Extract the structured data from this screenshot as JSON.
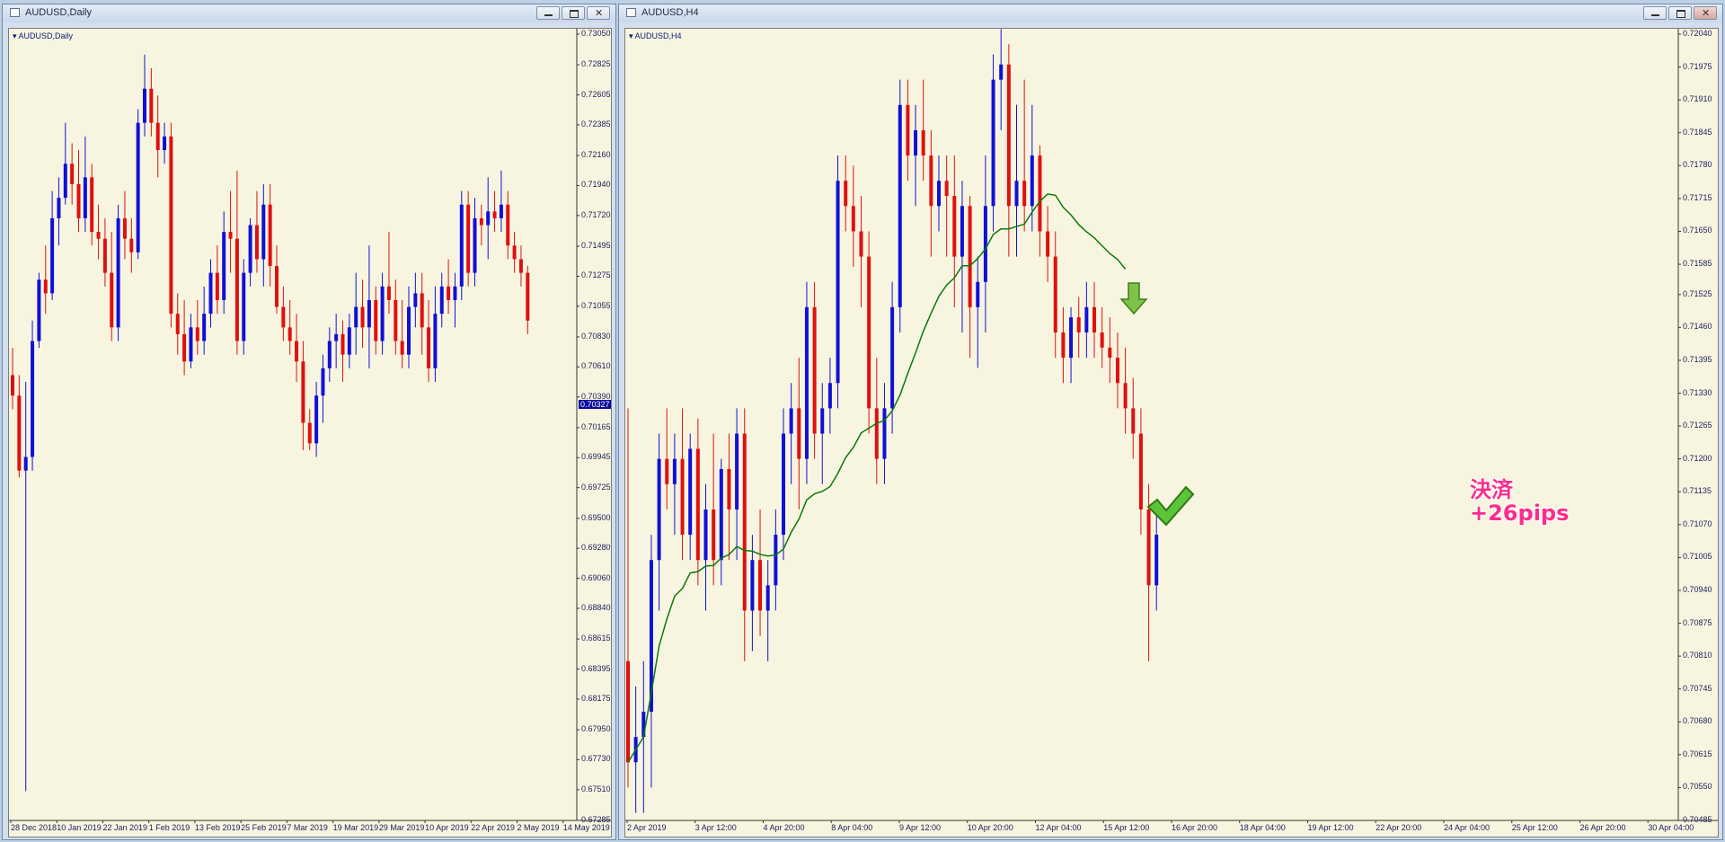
{
  "windows": [
    {
      "title": "AUDUSD,Daily",
      "symbol_label": "AUDUSD,Daily",
      "price_tag": "0.70327",
      "y_labels": [
        "0.73050",
        "0.72825",
        "0.72605",
        "0.72385",
        "0.72160",
        "0.71940",
        "0.71720",
        "0.71495",
        "0.71275",
        "0.71055",
        "0.70830",
        "0.70610",
        "0.70390",
        "0.70165",
        "0.69945",
        "0.69725",
        "0.69500",
        "0.69280",
        "0.69060",
        "0.68840",
        "0.68615",
        "0.68395",
        "0.68175",
        "0.67950",
        "0.67730",
        "0.67510",
        "0.67285"
      ],
      "x_labels": [
        "28 Dec 2018",
        "10 Jan 2019",
        "22 Jan 2019",
        "1 Feb 2019",
        "13 Feb 2019",
        "25 Feb 2019",
        "7 Mar 2019",
        "19 Mar 2019",
        "29 Mar 2019",
        "10 Apr 2019",
        "22 Apr 2019",
        "2 May 2019",
        "14 May 2019"
      ]
    },
    {
      "title": "AUDUSD,H4",
      "symbol_label": "AUDUSD,H4",
      "y_labels": [
        "0.72040",
        "0.71975",
        "0.71910",
        "0.71845",
        "0.71780",
        "0.71715",
        "0.71650",
        "0.71585",
        "0.71525",
        "0.71460",
        "0.71395",
        "0.71330",
        "0.71265",
        "0.71200",
        "0.71135",
        "0.71070",
        "0.71005",
        "0.70940",
        "0.70875",
        "0.70810",
        "0.70745",
        "0.70680",
        "0.70615",
        "0.70550",
        "0.70485"
      ],
      "x_labels": [
        "2 Apr 2019",
        "3 Apr 12:00",
        "4 Apr 20:00",
        "8 Apr 04:00",
        "9 Apr 12:00",
        "10 Apr 20:00",
        "12 Apr 04:00",
        "15 Apr 12:00",
        "16 Apr 20:00",
        "18 Apr 04:00",
        "19 Apr 12:00",
        "22 Apr 20:00",
        "24 Apr 04:00",
        "25 Apr 12:00",
        "26 Apr 20:00",
        "30 Apr 04:00"
      ],
      "annotation_line1": "決済",
      "annotation_line2": "+26pips"
    }
  ],
  "colors": {
    "bull": "#1010d8",
    "bear": "#e01010",
    "ma": "#0a7a0a",
    "bg": "#f7f5df",
    "annotation": "#ff2b8c"
  },
  "chart_data": [
    {
      "type": "candlestick",
      "title": "AUDUSD,Daily",
      "ylim": [
        0.67285,
        0.7305
      ],
      "series": [
        {
          "o": 0.7055,
          "h": 0.7075,
          "l": 0.703,
          "c": 0.704
        },
        {
          "o": 0.704,
          "h": 0.7055,
          "l": 0.698,
          "c": 0.6985
        },
        {
          "o": 0.6985,
          "h": 0.705,
          "l": 0.675,
          "c": 0.6995
        },
        {
          "o": 0.6995,
          "h": 0.7095,
          "l": 0.6985,
          "c": 0.708
        },
        {
          "o": 0.708,
          "h": 0.713,
          "l": 0.7075,
          "c": 0.7125
        },
        {
          "o": 0.7125,
          "h": 0.715,
          "l": 0.71,
          "c": 0.7115
        },
        {
          "o": 0.7115,
          "h": 0.719,
          "l": 0.711,
          "c": 0.717
        },
        {
          "o": 0.717,
          "h": 0.72,
          "l": 0.715,
          "c": 0.7185
        },
        {
          "o": 0.7185,
          "h": 0.724,
          "l": 0.718,
          "c": 0.721
        },
        {
          "o": 0.721,
          "h": 0.7225,
          "l": 0.718,
          "c": 0.7195
        },
        {
          "o": 0.7195,
          "h": 0.722,
          "l": 0.716,
          "c": 0.717
        },
        {
          "o": 0.717,
          "h": 0.723,
          "l": 0.716,
          "c": 0.72
        },
        {
          "o": 0.72,
          "h": 0.721,
          "l": 0.715,
          "c": 0.716
        },
        {
          "o": 0.716,
          "h": 0.718,
          "l": 0.714,
          "c": 0.7155
        },
        {
          "o": 0.7155,
          "h": 0.717,
          "l": 0.712,
          "c": 0.713
        },
        {
          "o": 0.713,
          "h": 0.716,
          "l": 0.708,
          "c": 0.709
        },
        {
          "o": 0.709,
          "h": 0.718,
          "l": 0.708,
          "c": 0.717
        },
        {
          "o": 0.717,
          "h": 0.719,
          "l": 0.714,
          "c": 0.7155
        },
        {
          "o": 0.7155,
          "h": 0.717,
          "l": 0.713,
          "c": 0.7145
        },
        {
          "o": 0.7145,
          "h": 0.725,
          "l": 0.714,
          "c": 0.724
        },
        {
          "o": 0.724,
          "h": 0.729,
          "l": 0.723,
          "c": 0.7265
        },
        {
          "o": 0.7265,
          "h": 0.728,
          "l": 0.723,
          "c": 0.724
        },
        {
          "o": 0.724,
          "h": 0.726,
          "l": 0.72,
          "c": 0.722
        },
        {
          "o": 0.722,
          "h": 0.724,
          "l": 0.721,
          "c": 0.723
        },
        {
          "o": 0.723,
          "h": 0.724,
          "l": 0.709,
          "c": 0.71
        },
        {
          "o": 0.71,
          "h": 0.7115,
          "l": 0.707,
          "c": 0.7085
        },
        {
          "o": 0.7085,
          "h": 0.711,
          "l": 0.7055,
          "c": 0.7065
        },
        {
          "o": 0.7065,
          "h": 0.71,
          "l": 0.706,
          "c": 0.709
        },
        {
          "o": 0.709,
          "h": 0.711,
          "l": 0.707,
          "c": 0.708
        },
        {
          "o": 0.708,
          "h": 0.712,
          "l": 0.707,
          "c": 0.71
        },
        {
          "o": 0.71,
          "h": 0.714,
          "l": 0.709,
          "c": 0.713
        },
        {
          "o": 0.713,
          "h": 0.715,
          "l": 0.71,
          "c": 0.711
        },
        {
          "o": 0.711,
          "h": 0.7175,
          "l": 0.71,
          "c": 0.716
        },
        {
          "o": 0.716,
          "h": 0.719,
          "l": 0.713,
          "c": 0.7155
        },
        {
          "o": 0.7155,
          "h": 0.7205,
          "l": 0.707,
          "c": 0.708
        },
        {
          "o": 0.708,
          "h": 0.714,
          "l": 0.707,
          "c": 0.713
        },
        {
          "o": 0.713,
          "h": 0.717,
          "l": 0.712,
          "c": 0.7165
        },
        {
          "o": 0.7165,
          "h": 0.719,
          "l": 0.713,
          "c": 0.714
        },
        {
          "o": 0.714,
          "h": 0.7195,
          "l": 0.712,
          "c": 0.718
        },
        {
          "o": 0.718,
          "h": 0.7195,
          "l": 0.712,
          "c": 0.7135
        },
        {
          "o": 0.7135,
          "h": 0.715,
          "l": 0.71,
          "c": 0.7105
        },
        {
          "o": 0.7105,
          "h": 0.712,
          "l": 0.708,
          "c": 0.709
        },
        {
          "o": 0.709,
          "h": 0.711,
          "l": 0.707,
          "c": 0.708
        },
        {
          "o": 0.708,
          "h": 0.71,
          "l": 0.705,
          "c": 0.7065
        },
        {
          "o": 0.7065,
          "h": 0.708,
          "l": 0.7,
          "c": 0.702
        },
        {
          "o": 0.702,
          "h": 0.703,
          "l": 0.7,
          "c": 0.7005
        },
        {
          "o": 0.7005,
          "h": 0.705,
          "l": 0.6995,
          "c": 0.704
        },
        {
          "o": 0.704,
          "h": 0.707,
          "l": 0.702,
          "c": 0.706
        },
        {
          "o": 0.706,
          "h": 0.709,
          "l": 0.705,
          "c": 0.708
        },
        {
          "o": 0.708,
          "h": 0.71,
          "l": 0.706,
          "c": 0.7085
        },
        {
          "o": 0.7085,
          "h": 0.7095,
          "l": 0.705,
          "c": 0.707
        },
        {
          "o": 0.707,
          "h": 0.71,
          "l": 0.706,
          "c": 0.709
        },
        {
          "o": 0.709,
          "h": 0.713,
          "l": 0.707,
          "c": 0.7105
        },
        {
          "o": 0.7105,
          "h": 0.7125,
          "l": 0.7075,
          "c": 0.709
        },
        {
          "o": 0.709,
          "h": 0.715,
          "l": 0.706,
          "c": 0.711
        },
        {
          "o": 0.711,
          "h": 0.712,
          "l": 0.707,
          "c": 0.708
        },
        {
          "o": 0.708,
          "h": 0.713,
          "l": 0.707,
          "c": 0.712
        },
        {
          "o": 0.712,
          "h": 0.716,
          "l": 0.71,
          "c": 0.711
        },
        {
          "o": 0.711,
          "h": 0.7125,
          "l": 0.707,
          "c": 0.708
        },
        {
          "o": 0.708,
          "h": 0.711,
          "l": 0.706,
          "c": 0.707
        },
        {
          "o": 0.707,
          "h": 0.712,
          "l": 0.706,
          "c": 0.7105
        },
        {
          "o": 0.7105,
          "h": 0.713,
          "l": 0.709,
          "c": 0.7115
        },
        {
          "o": 0.7115,
          "h": 0.713,
          "l": 0.707,
          "c": 0.709
        },
        {
          "o": 0.709,
          "h": 0.711,
          "l": 0.705,
          "c": 0.706
        },
        {
          "o": 0.706,
          "h": 0.712,
          "l": 0.705,
          "c": 0.71
        },
        {
          "o": 0.71,
          "h": 0.713,
          "l": 0.709,
          "c": 0.712
        },
        {
          "o": 0.712,
          "h": 0.714,
          "l": 0.71,
          "c": 0.711
        },
        {
          "o": 0.711,
          "h": 0.713,
          "l": 0.709,
          "c": 0.712
        },
        {
          "o": 0.712,
          "h": 0.719,
          "l": 0.711,
          "c": 0.718
        },
        {
          "o": 0.718,
          "h": 0.719,
          "l": 0.712,
          "c": 0.713
        },
        {
          "o": 0.713,
          "h": 0.7185,
          "l": 0.712,
          "c": 0.717
        },
        {
          "o": 0.717,
          "h": 0.718,
          "l": 0.715,
          "c": 0.7165
        },
        {
          "o": 0.7165,
          "h": 0.72,
          "l": 0.714,
          "c": 0.7175
        },
        {
          "o": 0.7175,
          "h": 0.719,
          "l": 0.716,
          "c": 0.717
        },
        {
          "o": 0.717,
          "h": 0.7205,
          "l": 0.716,
          "c": 0.718
        },
        {
          "o": 0.718,
          "h": 0.719,
          "l": 0.714,
          "c": 0.715
        },
        {
          "o": 0.715,
          "h": 0.716,
          "l": 0.713,
          "c": 0.714
        },
        {
          "o": 0.714,
          "h": 0.715,
          "l": 0.712,
          "c": 0.713
        },
        {
          "o": 0.713,
          "h": 0.7135,
          "l": 0.7085,
          "c": 0.7095
        }
      ]
    },
    {
      "type": "candlestick",
      "title": "AUDUSD,H4",
      "ylim": [
        0.70485,
        0.7204
      ],
      "series": [
        {
          "o": 0.708,
          "h": 0.713,
          "l": 0.7055,
          "c": 0.706
        },
        {
          "o": 0.706,
          "h": 0.7075,
          "l": 0.705,
          "c": 0.7065
        },
        {
          "o": 0.7065,
          "h": 0.708,
          "l": 0.705,
          "c": 0.707
        },
        {
          "o": 0.707,
          "h": 0.7105,
          "l": 0.7055,
          "c": 0.71
        },
        {
          "o": 0.71,
          "h": 0.7125,
          "l": 0.709,
          "c": 0.712
        },
        {
          "o": 0.712,
          "h": 0.713,
          "l": 0.711,
          "c": 0.7115
        },
        {
          "o": 0.7115,
          "h": 0.7125,
          "l": 0.7105,
          "c": 0.712
        },
        {
          "o": 0.712,
          "h": 0.713,
          "l": 0.71,
          "c": 0.7105
        },
        {
          "o": 0.7105,
          "h": 0.7125,
          "l": 0.71,
          "c": 0.7122
        },
        {
          "o": 0.7122,
          "h": 0.7128,
          "l": 0.7095,
          "c": 0.71
        },
        {
          "o": 0.71,
          "h": 0.7115,
          "l": 0.709,
          "c": 0.711
        },
        {
          "o": 0.711,
          "h": 0.7125,
          "l": 0.7095,
          "c": 0.71
        },
        {
          "o": 0.71,
          "h": 0.712,
          "l": 0.7095,
          "c": 0.7118
        },
        {
          "o": 0.7118,
          "h": 0.7125,
          "l": 0.71,
          "c": 0.711
        },
        {
          "o": 0.711,
          "h": 0.713,
          "l": 0.71,
          "c": 0.7125
        },
        {
          "o": 0.7125,
          "h": 0.713,
          "l": 0.708,
          "c": 0.709
        },
        {
          "o": 0.709,
          "h": 0.7105,
          "l": 0.7082,
          "c": 0.71
        },
        {
          "o": 0.71,
          "h": 0.711,
          "l": 0.7085,
          "c": 0.709
        },
        {
          "o": 0.709,
          "h": 0.71,
          "l": 0.708,
          "c": 0.7095
        },
        {
          "o": 0.7095,
          "h": 0.711,
          "l": 0.709,
          "c": 0.7105
        },
        {
          "o": 0.7105,
          "h": 0.713,
          "l": 0.71,
          "c": 0.7125
        },
        {
          "o": 0.7125,
          "h": 0.7135,
          "l": 0.7115,
          "c": 0.713
        },
        {
          "o": 0.713,
          "h": 0.714,
          "l": 0.711,
          "c": 0.712
        },
        {
          "o": 0.712,
          "h": 0.7155,
          "l": 0.7115,
          "c": 0.715
        },
        {
          "o": 0.715,
          "h": 0.7155,
          "l": 0.712,
          "c": 0.7125
        },
        {
          "o": 0.7125,
          "h": 0.7135,
          "l": 0.7115,
          "c": 0.713
        },
        {
          "o": 0.713,
          "h": 0.714,
          "l": 0.7125,
          "c": 0.7135
        },
        {
          "o": 0.7135,
          "h": 0.718,
          "l": 0.713,
          "c": 0.7175
        },
        {
          "o": 0.7175,
          "h": 0.718,
          "l": 0.7165,
          "c": 0.717
        },
        {
          "o": 0.717,
          "h": 0.7178,
          "l": 0.7158,
          "c": 0.7165
        },
        {
          "o": 0.7165,
          "h": 0.7172,
          "l": 0.715,
          "c": 0.716
        },
        {
          "o": 0.716,
          "h": 0.7165,
          "l": 0.7125,
          "c": 0.713
        },
        {
          "o": 0.713,
          "h": 0.714,
          "l": 0.7115,
          "c": 0.712
        },
        {
          "o": 0.712,
          "h": 0.7135,
          "l": 0.7115,
          "c": 0.713
        },
        {
          "o": 0.713,
          "h": 0.7155,
          "l": 0.7125,
          "c": 0.715
        },
        {
          "o": 0.715,
          "h": 0.7195,
          "l": 0.7145,
          "c": 0.719
        },
        {
          "o": 0.719,
          "h": 0.7195,
          "l": 0.7175,
          "c": 0.718
        },
        {
          "o": 0.718,
          "h": 0.719,
          "l": 0.717,
          "c": 0.7185
        },
        {
          "o": 0.7185,
          "h": 0.7195,
          "l": 0.7175,
          "c": 0.718
        },
        {
          "o": 0.718,
          "h": 0.7185,
          "l": 0.716,
          "c": 0.717
        },
        {
          "o": 0.717,
          "h": 0.718,
          "l": 0.7165,
          "c": 0.7175
        },
        {
          "o": 0.7175,
          "h": 0.718,
          "l": 0.716,
          "c": 0.7172
        },
        {
          "o": 0.7172,
          "h": 0.718,
          "l": 0.715,
          "c": 0.716
        },
        {
          "o": 0.716,
          "h": 0.7175,
          "l": 0.7145,
          "c": 0.717
        },
        {
          "o": 0.717,
          "h": 0.7172,
          "l": 0.714,
          "c": 0.715
        },
        {
          "o": 0.715,
          "h": 0.716,
          "l": 0.7138,
          "c": 0.7155
        },
        {
          "o": 0.7155,
          "h": 0.718,
          "l": 0.7145,
          "c": 0.717
        },
        {
          "o": 0.717,
          "h": 0.72,
          "l": 0.7165,
          "c": 0.7195
        },
        {
          "o": 0.7195,
          "h": 0.7205,
          "l": 0.7185,
          "c": 0.7198
        },
        {
          "o": 0.7198,
          "h": 0.7202,
          "l": 0.716,
          "c": 0.717
        },
        {
          "o": 0.717,
          "h": 0.719,
          "l": 0.716,
          "c": 0.7175
        },
        {
          "o": 0.7175,
          "h": 0.7195,
          "l": 0.7165,
          "c": 0.717
        },
        {
          "o": 0.717,
          "h": 0.719,
          "l": 0.7165,
          "c": 0.718
        },
        {
          "o": 0.718,
          "h": 0.7182,
          "l": 0.716,
          "c": 0.7165
        },
        {
          "o": 0.7165,
          "h": 0.717,
          "l": 0.7155,
          "c": 0.716
        },
        {
          "o": 0.716,
          "h": 0.7165,
          "l": 0.714,
          "c": 0.7145
        },
        {
          "o": 0.7145,
          "h": 0.715,
          "l": 0.7135,
          "c": 0.714
        },
        {
          "o": 0.714,
          "h": 0.715,
          "l": 0.7135,
          "c": 0.7148
        },
        {
          "o": 0.7148,
          "h": 0.7152,
          "l": 0.714,
          "c": 0.7145
        },
        {
          "o": 0.7145,
          "h": 0.7155,
          "l": 0.714,
          "c": 0.715
        },
        {
          "o": 0.715,
          "h": 0.7155,
          "l": 0.714,
          "c": 0.7145
        },
        {
          "o": 0.7145,
          "h": 0.715,
          "l": 0.7138,
          "c": 0.7142
        },
        {
          "o": 0.7142,
          "h": 0.7148,
          "l": 0.7135,
          "c": 0.714
        },
        {
          "o": 0.714,
          "h": 0.7145,
          "l": 0.713,
          "c": 0.7135
        },
        {
          "o": 0.7135,
          "h": 0.7142,
          "l": 0.7125,
          "c": 0.713
        },
        {
          "o": 0.713,
          "h": 0.7136,
          "l": 0.712,
          "c": 0.7125
        },
        {
          "o": 0.7125,
          "h": 0.713,
          "l": 0.7105,
          "c": 0.711
        },
        {
          "o": 0.711,
          "h": 0.7115,
          "l": 0.708,
          "c": 0.7095
        },
        {
          "o": 0.7095,
          "h": 0.711,
          "l": 0.709,
          "c": 0.7105
        }
      ]
    }
  ]
}
